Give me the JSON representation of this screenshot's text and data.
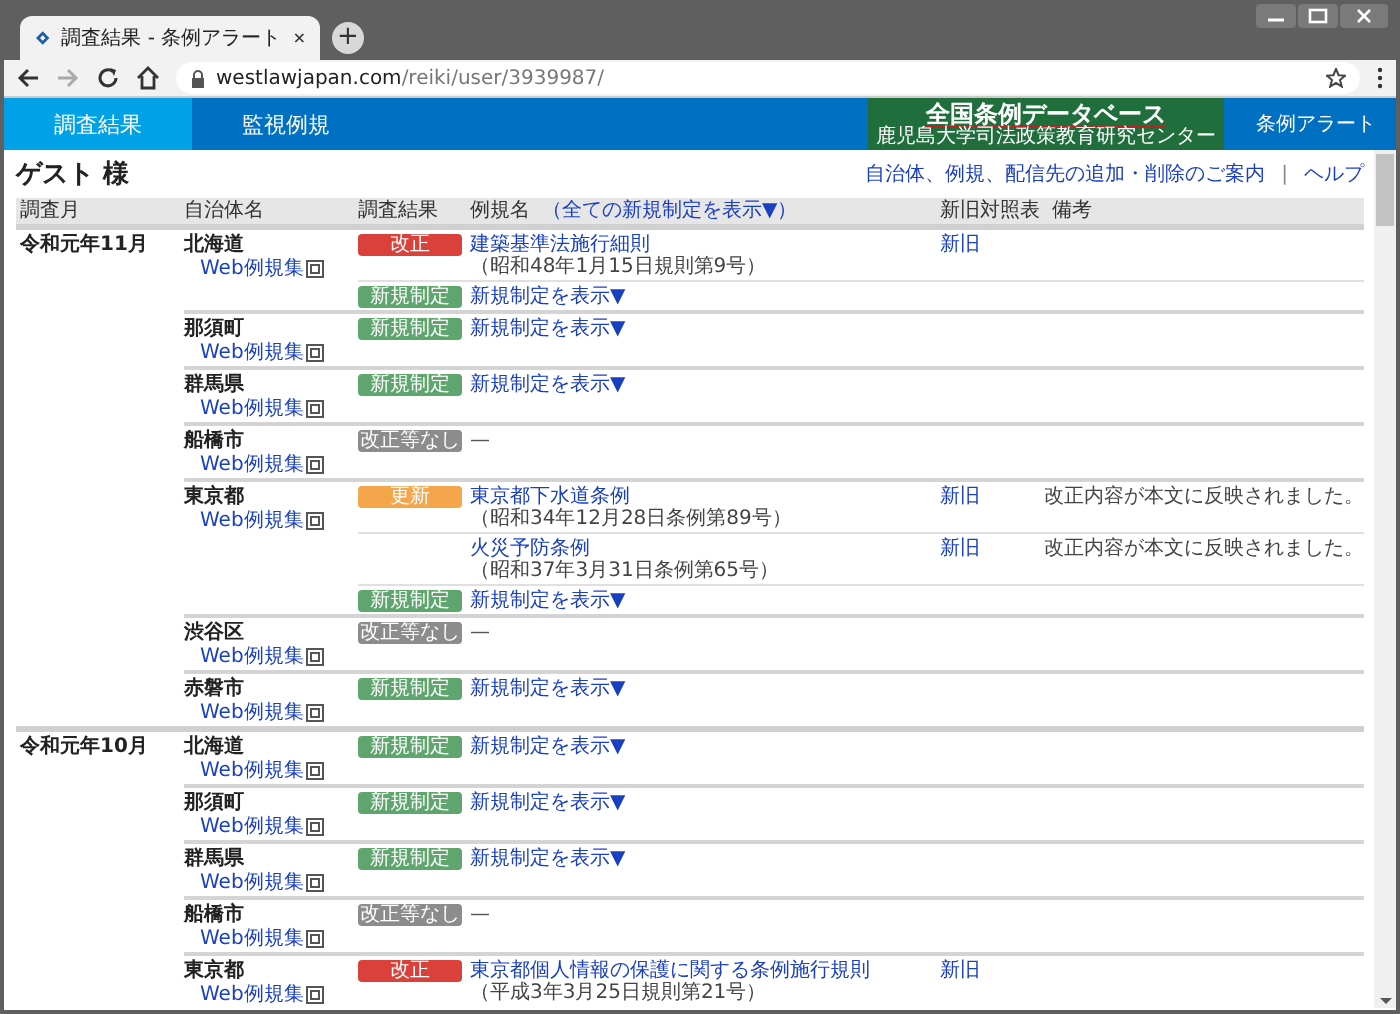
{
  "browser": {
    "tab_title": "調査結果 - 条例アラート",
    "new_tab": "+",
    "url_host": "westlawjapan.com",
    "url_path": "/reiki/user/3939987/"
  },
  "nav": {
    "tabs": [
      {
        "label": "調査結果",
        "selected": true
      },
      {
        "label": "監視例規",
        "selected": false
      }
    ],
    "logo_title": "全国条例データベース",
    "logo_subtitle": "鹿児島大学司法政策教育研究センター",
    "right_link": "条例アラート"
  },
  "page": {
    "user": "ゲスト 様",
    "links": [
      "自治体、例規、配信先の追加・削除のご案内",
      "ヘルプ"
    ],
    "separator": "|"
  },
  "table": {
    "columns": {
      "month": "調査月",
      "name": "自治体名",
      "result": "調査結果",
      "law": "例規名",
      "show_all": "（全ての新規制定を表示▼）",
      "diff": "新旧対照表",
      "note": "備考"
    },
    "groups": [
      {
        "month": "令和元年11月",
        "entities": [
          {
            "name": "北海道",
            "web_link": "Web例規集",
            "results": [
              {
                "color": "#d9413a",
                "badge": "改正",
                "kind": "law",
                "title": "建築基準法施行細則",
                "number": "（昭和48年1月15日規則第9号）",
                "diff": "新旧"
              },
              {
                "color": "#5ea66d",
                "badge": "新規制定",
                "kind": "expand",
                "text": "新規制定を表示▼"
              }
            ]
          },
          {
            "name": "那須町",
            "web_link": "Web例規集",
            "results": [
              {
                "color": "#5ea66d",
                "badge": "新規制定",
                "kind": "expand",
                "text": "新規制定を表示▼"
              }
            ]
          },
          {
            "name": "群馬県",
            "web_link": "Web例規集",
            "results": [
              {
                "color": "#5ea66d",
                "badge": "新規制定",
                "kind": "expand",
                "text": "新規制定を表示▼"
              }
            ]
          },
          {
            "name": "船橋市",
            "web_link": "Web例規集",
            "results": [
              {
                "color": "#8c8c8c",
                "badge": "改正等なし",
                "kind": "none",
                "text": "—"
              }
            ]
          },
          {
            "name": "東京都",
            "web_link": "Web例規集",
            "results": [
              {
                "color": "#f5a54a",
                "badge": "更新",
                "kind": "law",
                "title": "東京都下水道条例",
                "number": "（昭和34年12月28日条例第89号）",
                "diff": "新旧",
                "note": "改正内容が本文に反映されました。"
              },
              {
                "kind": "law",
                "title": "火災予防条例",
                "number": "（昭和37年3月31日条例第65号）",
                "diff": "新旧",
                "note": "改正内容が本文に反映されました。"
              },
              {
                "color": "#5ea66d",
                "badge": "新規制定",
                "kind": "expand",
                "text": "新規制定を表示▼"
              }
            ]
          },
          {
            "name": "渋谷区",
            "web_link": "Web例規集",
            "results": [
              {
                "color": "#8c8c8c",
                "badge": "改正等なし",
                "kind": "none",
                "text": "—"
              }
            ]
          },
          {
            "name": "赤磐市",
            "web_link": "Web例規集",
            "results": [
              {
                "color": "#5ea66d",
                "badge": "新規制定",
                "kind": "expand",
                "text": "新規制定を表示▼"
              }
            ]
          }
        ]
      },
      {
        "month": "令和元年10月",
        "entities": [
          {
            "name": "北海道",
            "web_link": "Web例規集",
            "results": [
              {
                "color": "#5ea66d",
                "badge": "新規制定",
                "kind": "expand",
                "text": "新規制定を表示▼"
              }
            ]
          },
          {
            "name": "那須町",
            "web_link": "Web例規集",
            "results": [
              {
                "color": "#5ea66d",
                "badge": "新規制定",
                "kind": "expand",
                "text": "新規制定を表示▼"
              }
            ]
          },
          {
            "name": "群馬県",
            "web_link": "Web例規集",
            "results": [
              {
                "color": "#5ea66d",
                "badge": "新規制定",
                "kind": "expand",
                "text": "新規制定を表示▼"
              }
            ]
          },
          {
            "name": "船橋市",
            "web_link": "Web例規集",
            "results": [
              {
                "color": "#8c8c8c",
                "badge": "改正等なし",
                "kind": "none",
                "text": "—"
              }
            ]
          },
          {
            "name": "東京都",
            "web_link": "Web例規集",
            "results": [
              {
                "color": "#d9413a",
                "badge": "改正",
                "kind": "law",
                "title": "東京都個人情報の保護に関する条例施行規則",
                "number": "（平成3年3月25日規則第21号）",
                "diff": "新旧"
              }
            ]
          }
        ]
      }
    ]
  }
}
